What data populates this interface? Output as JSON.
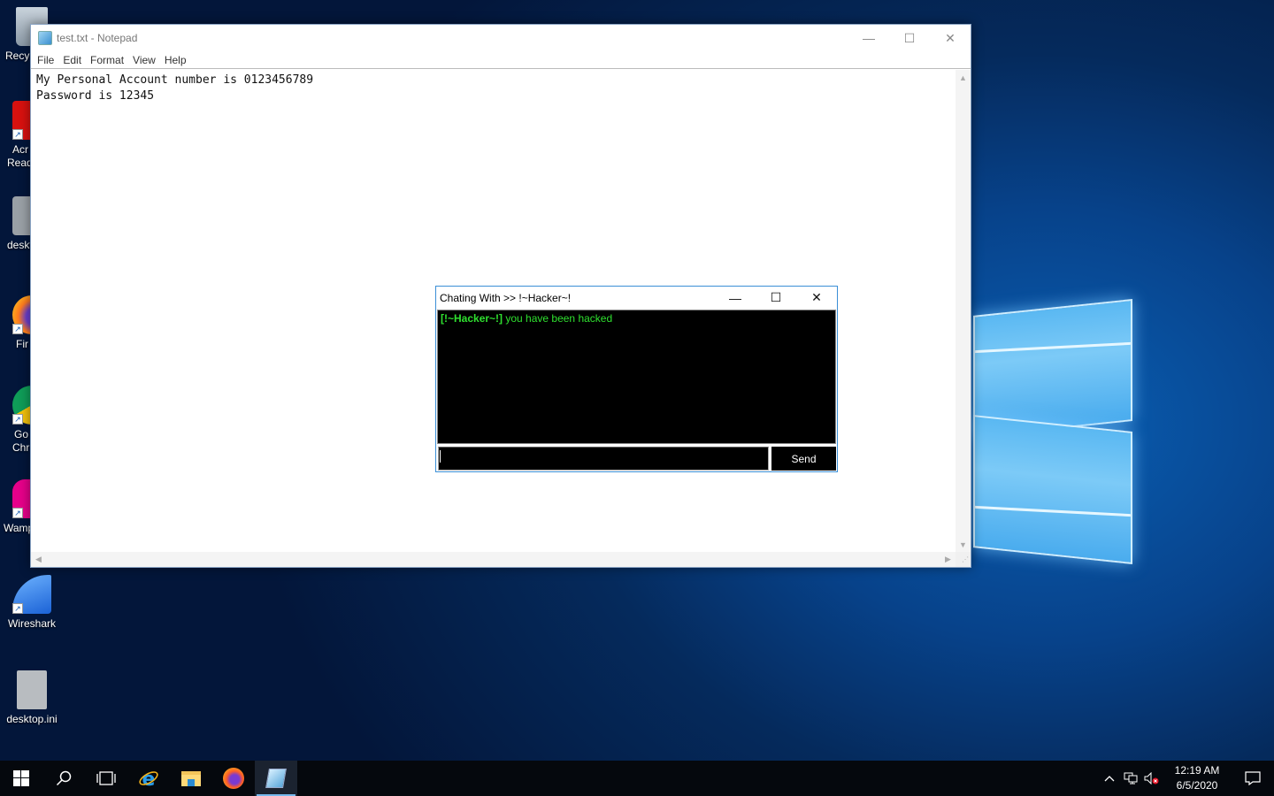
{
  "desktop": {
    "icons": [
      {
        "label": "Recycle Bin",
        "visible_label": "Recy"
      },
      {
        "label": "Acrobat Reader",
        "visible_label_line1": "Acr",
        "visible_label_line2": "Read"
      },
      {
        "label": "desktop",
        "visible_label": "deskt"
      },
      {
        "label": "Firefox",
        "visible_label": "Fir"
      },
      {
        "label": "Google Chrome",
        "visible_label_line1": "Go",
        "visible_label_line2": "Chr"
      },
      {
        "label": "Wamp",
        "visible_label": "Wamp"
      },
      {
        "label": "Wireshark",
        "visible_label": "Wireshark"
      },
      {
        "label": "desktop.ini",
        "visible_label": "desktop.ini"
      }
    ]
  },
  "notepad": {
    "title": "test.txt - Notepad",
    "menu": [
      "File",
      "Edit",
      "Format",
      "View",
      "Help"
    ],
    "content_lines": [
      "My Personal Account number is 0123456789",
      "Password is 12345"
    ],
    "buttons": {
      "minimize": "—",
      "maximize": "☐",
      "close": "✕"
    }
  },
  "chat": {
    "title": "Chating With >> !~Hacker~!",
    "messages": [
      {
        "sender": "[!~Hacker~!]",
        "text": "you have been hacked"
      }
    ],
    "input_value": "",
    "send_label": "Send",
    "buttons": {
      "minimize": "—",
      "maximize": "☐",
      "close": "✕"
    },
    "colors": {
      "message": "#2fe02f",
      "background": "#000000"
    }
  },
  "taskbar": {
    "pinned": [
      "Start",
      "Search",
      "Task View",
      "Internet Explorer",
      "File Explorer",
      "Firefox",
      "Notepad"
    ],
    "active": "Notepad",
    "clock": {
      "time": "12:19 AM",
      "date": "6/5/2020"
    },
    "tray": [
      "show-hidden-icons",
      "network",
      "volume-muted",
      "action-center"
    ]
  }
}
